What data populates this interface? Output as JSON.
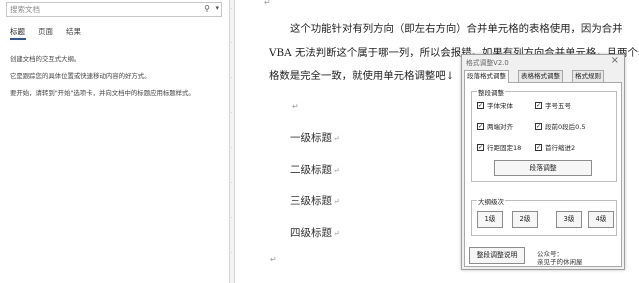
{
  "nav": {
    "search_placeholder": "搜索文档",
    "search_icon": "magnifier-icon",
    "dropdown_icon": "caret-down-icon",
    "tabs": [
      {
        "label": "标题"
      },
      {
        "label": "页面"
      },
      {
        "label": "结果"
      }
    ],
    "hints": [
      "创建文档的交互式大纲。",
      "它是跟踪您的具体位置或快速移动内容的好方式。",
      "要开始，请转到\"开始\"选项卡，并向文档中的标题应用标题样式。"
    ]
  },
  "doc": {
    "lines": [
      "这个功能针对有列方向（即左右方向）合并单元格的表格使用，因为合并",
      "VBA 无法判断这个属于哪一列，所以会报错。如果有列方向合并单元格，且两个表",
      "格数是完全一致，就使用单元格调整吧↓"
    ],
    "headings": [
      "一级标题",
      "二级标题",
      "三级标题",
      "四级标题"
    ],
    "para_mark": "↵"
  },
  "dialog": {
    "title": "格式调整V2.0",
    "close": "×",
    "tabs": [
      {
        "label": "段落格式调整"
      },
      {
        "label": "表格格式调整"
      },
      {
        "label": "格式规则"
      }
    ],
    "para_group": {
      "label": "整段调整",
      "options": [
        {
          "label": "字体宋体",
          "checked": true
        },
        {
          "label": "字号五号",
          "checked": true
        },
        {
          "label": "两端对齐",
          "checked": true
        },
        {
          "label": "段前0段后0.5",
          "checked": true
        },
        {
          "label": "行距固定18",
          "checked": true
        },
        {
          "label": "首行缩进2",
          "checked": true
        }
      ],
      "button": "段落调整"
    },
    "outline_group": {
      "label": "大纲级次",
      "levels": [
        "1级",
        "2级",
        "3级",
        "4级"
      ]
    },
    "help_button": "整段调整说明",
    "footer": [
      "公众号：",
      "亲见子的休闲屋"
    ]
  }
}
